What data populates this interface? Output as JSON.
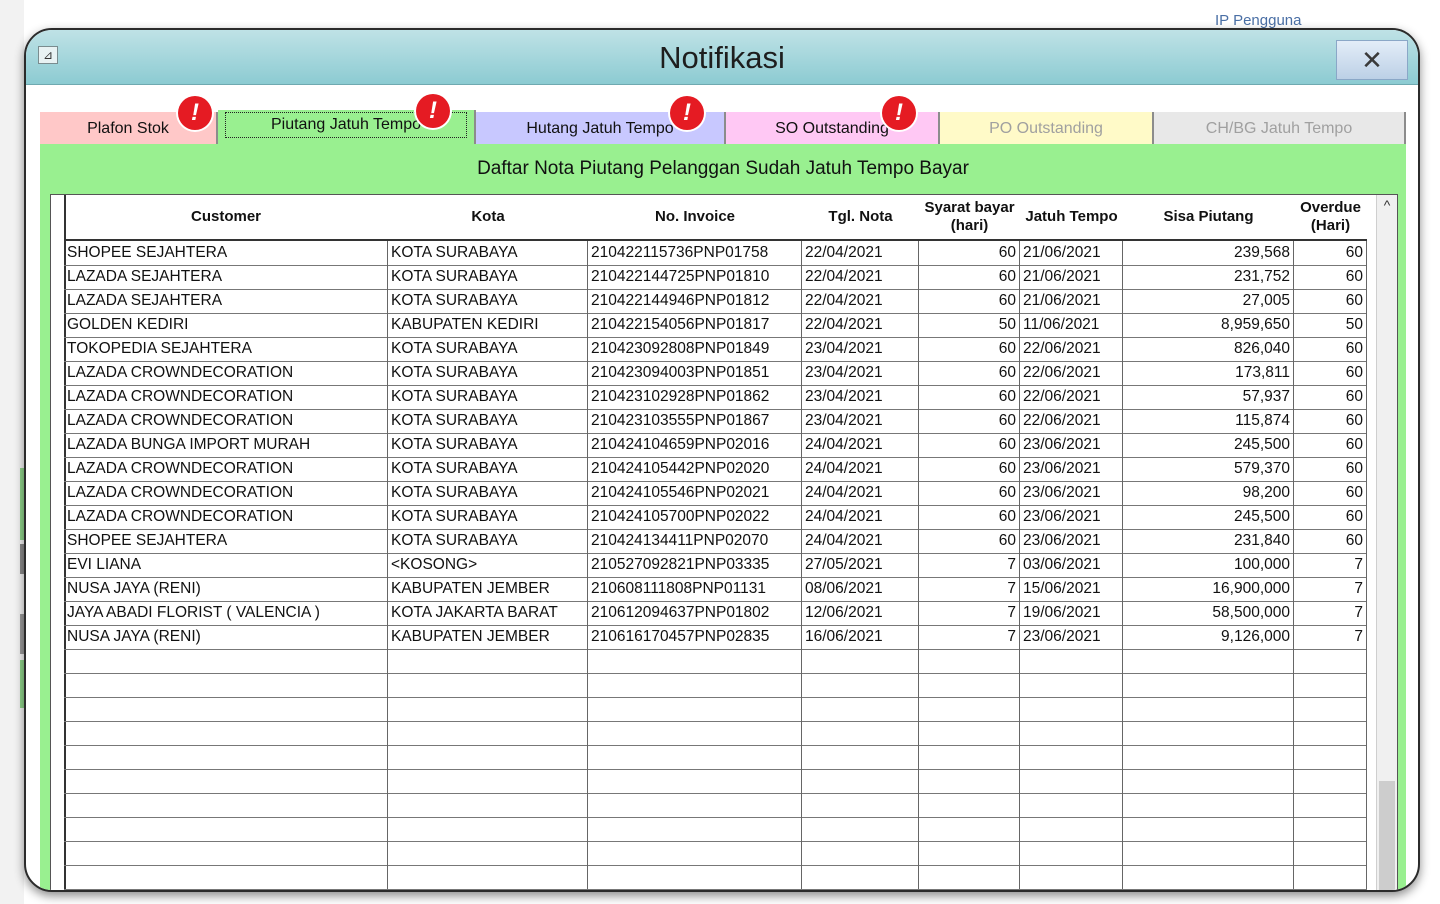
{
  "background": {
    "top_text": "IP Pengguna",
    "right_char": "a"
  },
  "window": {
    "title": "Notifikasi",
    "close_glyph": "✕",
    "title_icon_glyph": "⊿"
  },
  "tabs": [
    {
      "label": "Plafon Stok",
      "color": "#ffc8c8",
      "alert": true,
      "active": false,
      "dim": false
    },
    {
      "label": "Piutang Jatuh Tempo",
      "color": "#99f090",
      "alert": true,
      "active": true,
      "dim": false
    },
    {
      "label": "Hutang Jatuh Tempo",
      "color": "#c8c8ff",
      "alert": true,
      "active": false,
      "dim": false
    },
    {
      "label": "SO Outstanding",
      "color": "#ffc8f4",
      "alert": true,
      "active": false,
      "dim": false
    },
    {
      "label": "PO Outstanding",
      "color": "#fffac8",
      "alert": false,
      "active": false,
      "dim": true
    },
    {
      "label": "CH/BG Jatuh Tempo",
      "color": "#e8e8e8",
      "alert": false,
      "active": false,
      "dim": true
    }
  ],
  "alert_glyph": "!",
  "panel": {
    "title": "Daftar Nota Piutang Pelanggan Sudah Jatuh Tempo Bayar"
  },
  "table": {
    "columns": [
      "Customer",
      "Kota",
      "No. Invoice",
      "Tgl. Nota",
      "Syarat bayar (hari)",
      "Jatuh Tempo",
      "Sisa Piutang",
      "Overdue (Hari)"
    ],
    "rows": [
      [
        "SHOPEE SEJAHTERA",
        "KOTA SURABAYA",
        "210422115736PNP01758",
        "22/04/2021",
        "60",
        "21/06/2021",
        "239,568",
        "60"
      ],
      [
        "LAZADA SEJAHTERA",
        "KOTA SURABAYA",
        "210422144725PNP01810",
        "22/04/2021",
        "60",
        "21/06/2021",
        "231,752",
        "60"
      ],
      [
        "LAZADA SEJAHTERA",
        "KOTA SURABAYA",
        "210422144946PNP01812",
        "22/04/2021",
        "60",
        "21/06/2021",
        "27,005",
        "60"
      ],
      [
        "GOLDEN KEDIRI",
        "KABUPATEN KEDIRI",
        "210422154056PNP01817",
        "22/04/2021",
        "50",
        "11/06/2021",
        "8,959,650",
        "50"
      ],
      [
        "TOKOPEDIA SEJAHTERA",
        "KOTA SURABAYA",
        "210423092808PNP01849",
        "23/04/2021",
        "60",
        "22/06/2021",
        "826,040",
        "60"
      ],
      [
        "LAZADA CROWNDECORATION",
        "KOTA SURABAYA",
        "210423094003PNP01851",
        "23/04/2021",
        "60",
        "22/06/2021",
        "173,811",
        "60"
      ],
      [
        "LAZADA CROWNDECORATION",
        "KOTA SURABAYA",
        "210423102928PNP01862",
        "23/04/2021",
        "60",
        "22/06/2021",
        "57,937",
        "60"
      ],
      [
        "LAZADA CROWNDECORATION",
        "KOTA SURABAYA",
        "210423103555PNP01867",
        "23/04/2021",
        "60",
        "22/06/2021",
        "115,874",
        "60"
      ],
      [
        "LAZADA BUNGA IMPORT MURAH",
        "KOTA SURABAYA",
        "210424104659PNP02016",
        "24/04/2021",
        "60",
        "23/06/2021",
        "245,500",
        "60"
      ],
      [
        "LAZADA CROWNDECORATION",
        "KOTA SURABAYA",
        "210424105442PNP02020",
        "24/04/2021",
        "60",
        "23/06/2021",
        "579,370",
        "60"
      ],
      [
        "LAZADA CROWNDECORATION",
        "KOTA SURABAYA",
        "210424105546PNP02021",
        "24/04/2021",
        "60",
        "23/06/2021",
        "98,200",
        "60"
      ],
      [
        "LAZADA CROWNDECORATION",
        "KOTA SURABAYA",
        "210424105700PNP02022",
        "24/04/2021",
        "60",
        "23/06/2021",
        "245,500",
        "60"
      ],
      [
        "SHOPEE SEJAHTERA",
        "KOTA SURABAYA",
        "210424134411PNP02070",
        "24/04/2021",
        "60",
        "23/06/2021",
        "231,840",
        "60"
      ],
      [
        "EVI LIANA",
        "<KOSONG>",
        "210527092821PNP03335",
        "27/05/2021",
        "7",
        "03/06/2021",
        "100,000",
        "7"
      ],
      [
        "NUSA JAYA (RENI)",
        "KABUPATEN JEMBER",
        "210608111808PNP01131",
        "08/06/2021",
        "7",
        "15/06/2021",
        "16,900,000",
        "7"
      ],
      [
        "JAYA ABADI FLORIST ( VALENCIA )",
        "KOTA JAKARTA BARAT",
        "210612094637PNP01802",
        "12/06/2021",
        "7",
        "19/06/2021",
        "58,500,000",
        "7"
      ],
      [
        "NUSA JAYA (RENI)",
        "KABUPATEN JEMBER",
        "210616170457PNP02835",
        "16/06/2021",
        "7",
        "23/06/2021",
        "9,126,000",
        "7"
      ]
    ],
    "empty_rows": 10,
    "scroll_up_glyph": "^"
  }
}
